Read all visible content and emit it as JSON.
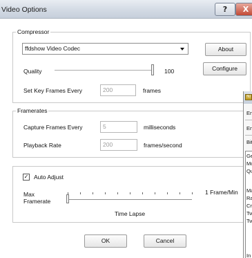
{
  "window": {
    "title": "Video Options",
    "help_label": "?",
    "close_label": "X"
  },
  "compressor": {
    "group_label": "Compressor",
    "codec_selected": "ffdshow Video Codec",
    "about_label": "About",
    "configure_label": "Configure",
    "quality_label": "Quality",
    "quality_value": "100",
    "quality_fraction": 1.0,
    "keyframes_label": "Set Key Frames Every",
    "keyframes_value": "200",
    "keyframes_unit": "frames"
  },
  "framerates": {
    "group_label": "Framerates",
    "capture_label": "Capture Frames Every",
    "capture_value": "5",
    "capture_unit": "milliseconds",
    "playback_label": "Playback Rate",
    "playback_value": "200",
    "playback_unit": "frames/second"
  },
  "auto_adjust": {
    "checkbox_label": "Auto Adjust",
    "checked": true,
    "check_mark": "✓",
    "max_label_line1": "Max",
    "max_label_line2": "Framerate",
    "right_label": "1 Frame/Min",
    "slider_caption": "Time Lapse",
    "slider_fraction": 0.0
  },
  "buttons": {
    "ok_label": "OK",
    "cancel_label": "Cancel"
  },
  "background_window": {
    "icon_text": "ffd",
    "rows": [
      "En",
      "En",
      "Bit",
      "Ge",
      "Mo",
      "Qu",
      "Ma",
      "Ra",
      "Cr",
      "Tw",
      "Tw",
      "In"
    ]
  },
  "colors": {
    "close_button": "#c24a36",
    "title_bar": "#d3dae4",
    "disabled_text": "#9b9b9b"
  }
}
